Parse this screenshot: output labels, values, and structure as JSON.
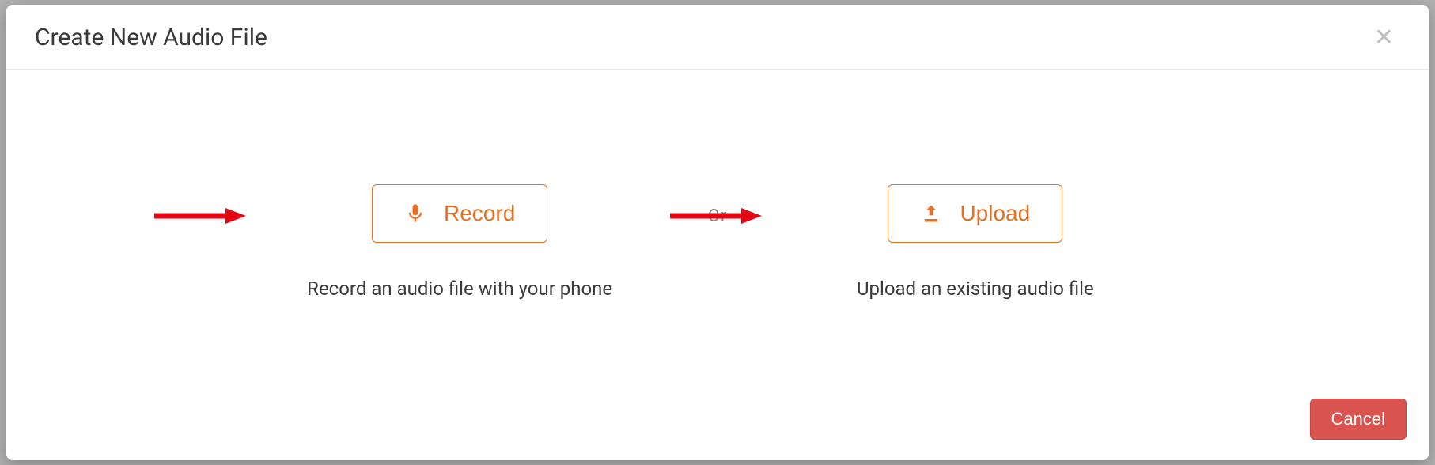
{
  "modal": {
    "title": "Create New Audio File",
    "separator": "- Or -",
    "record": {
      "button": "Record",
      "description": "Record an audio file with your phone"
    },
    "upload": {
      "button": "Upload",
      "description": "Upload an existing audio file"
    },
    "cancel": "Cancel"
  }
}
